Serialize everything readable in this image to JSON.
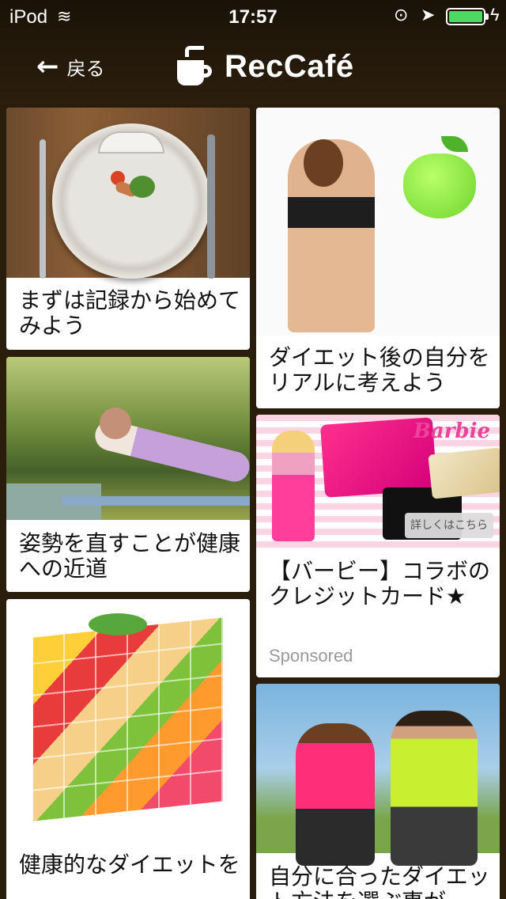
{
  "status_bar": {
    "carrier": "iPod",
    "time": "17:57",
    "battery_level": 0.95,
    "icons": [
      "wifi-icon",
      "orientation-lock-icon",
      "location-icon",
      "battery-icon",
      "charging-bolt-icon"
    ]
  },
  "header": {
    "back_label": "戻る",
    "brand_name": "RecCafé"
  },
  "articles": {
    "left": [
      {
        "title": "まずは記録から始めてみよう",
        "image": "plate-with-scale-photo"
      },
      {
        "title": "姿勢を直すことが健康への近道",
        "image": "yoga-outdoor-photo"
      },
      {
        "title": "健康的なダイエットを",
        "image": "fruit-cube-photo"
      }
    ],
    "right": [
      {
        "title": "ダイエット後の自分をリアルに考えよう",
        "image": "woman-apple-photo"
      },
      {
        "title": "【バービー】コラボのクレジットカード★",
        "image": "barbie-credit-card-ad",
        "sponsored_label": "Sponsored",
        "banner_logo": "Barbie",
        "banner_button": "詳しくはこちら"
      },
      {
        "title": "自分に合ったダイエット方法を選ぶ事が",
        "image": "couple-running-photo"
      }
    ]
  },
  "colors": {
    "background": "#2a1d0c",
    "card": "#ffffff",
    "accent_pink": "#f0429a"
  }
}
